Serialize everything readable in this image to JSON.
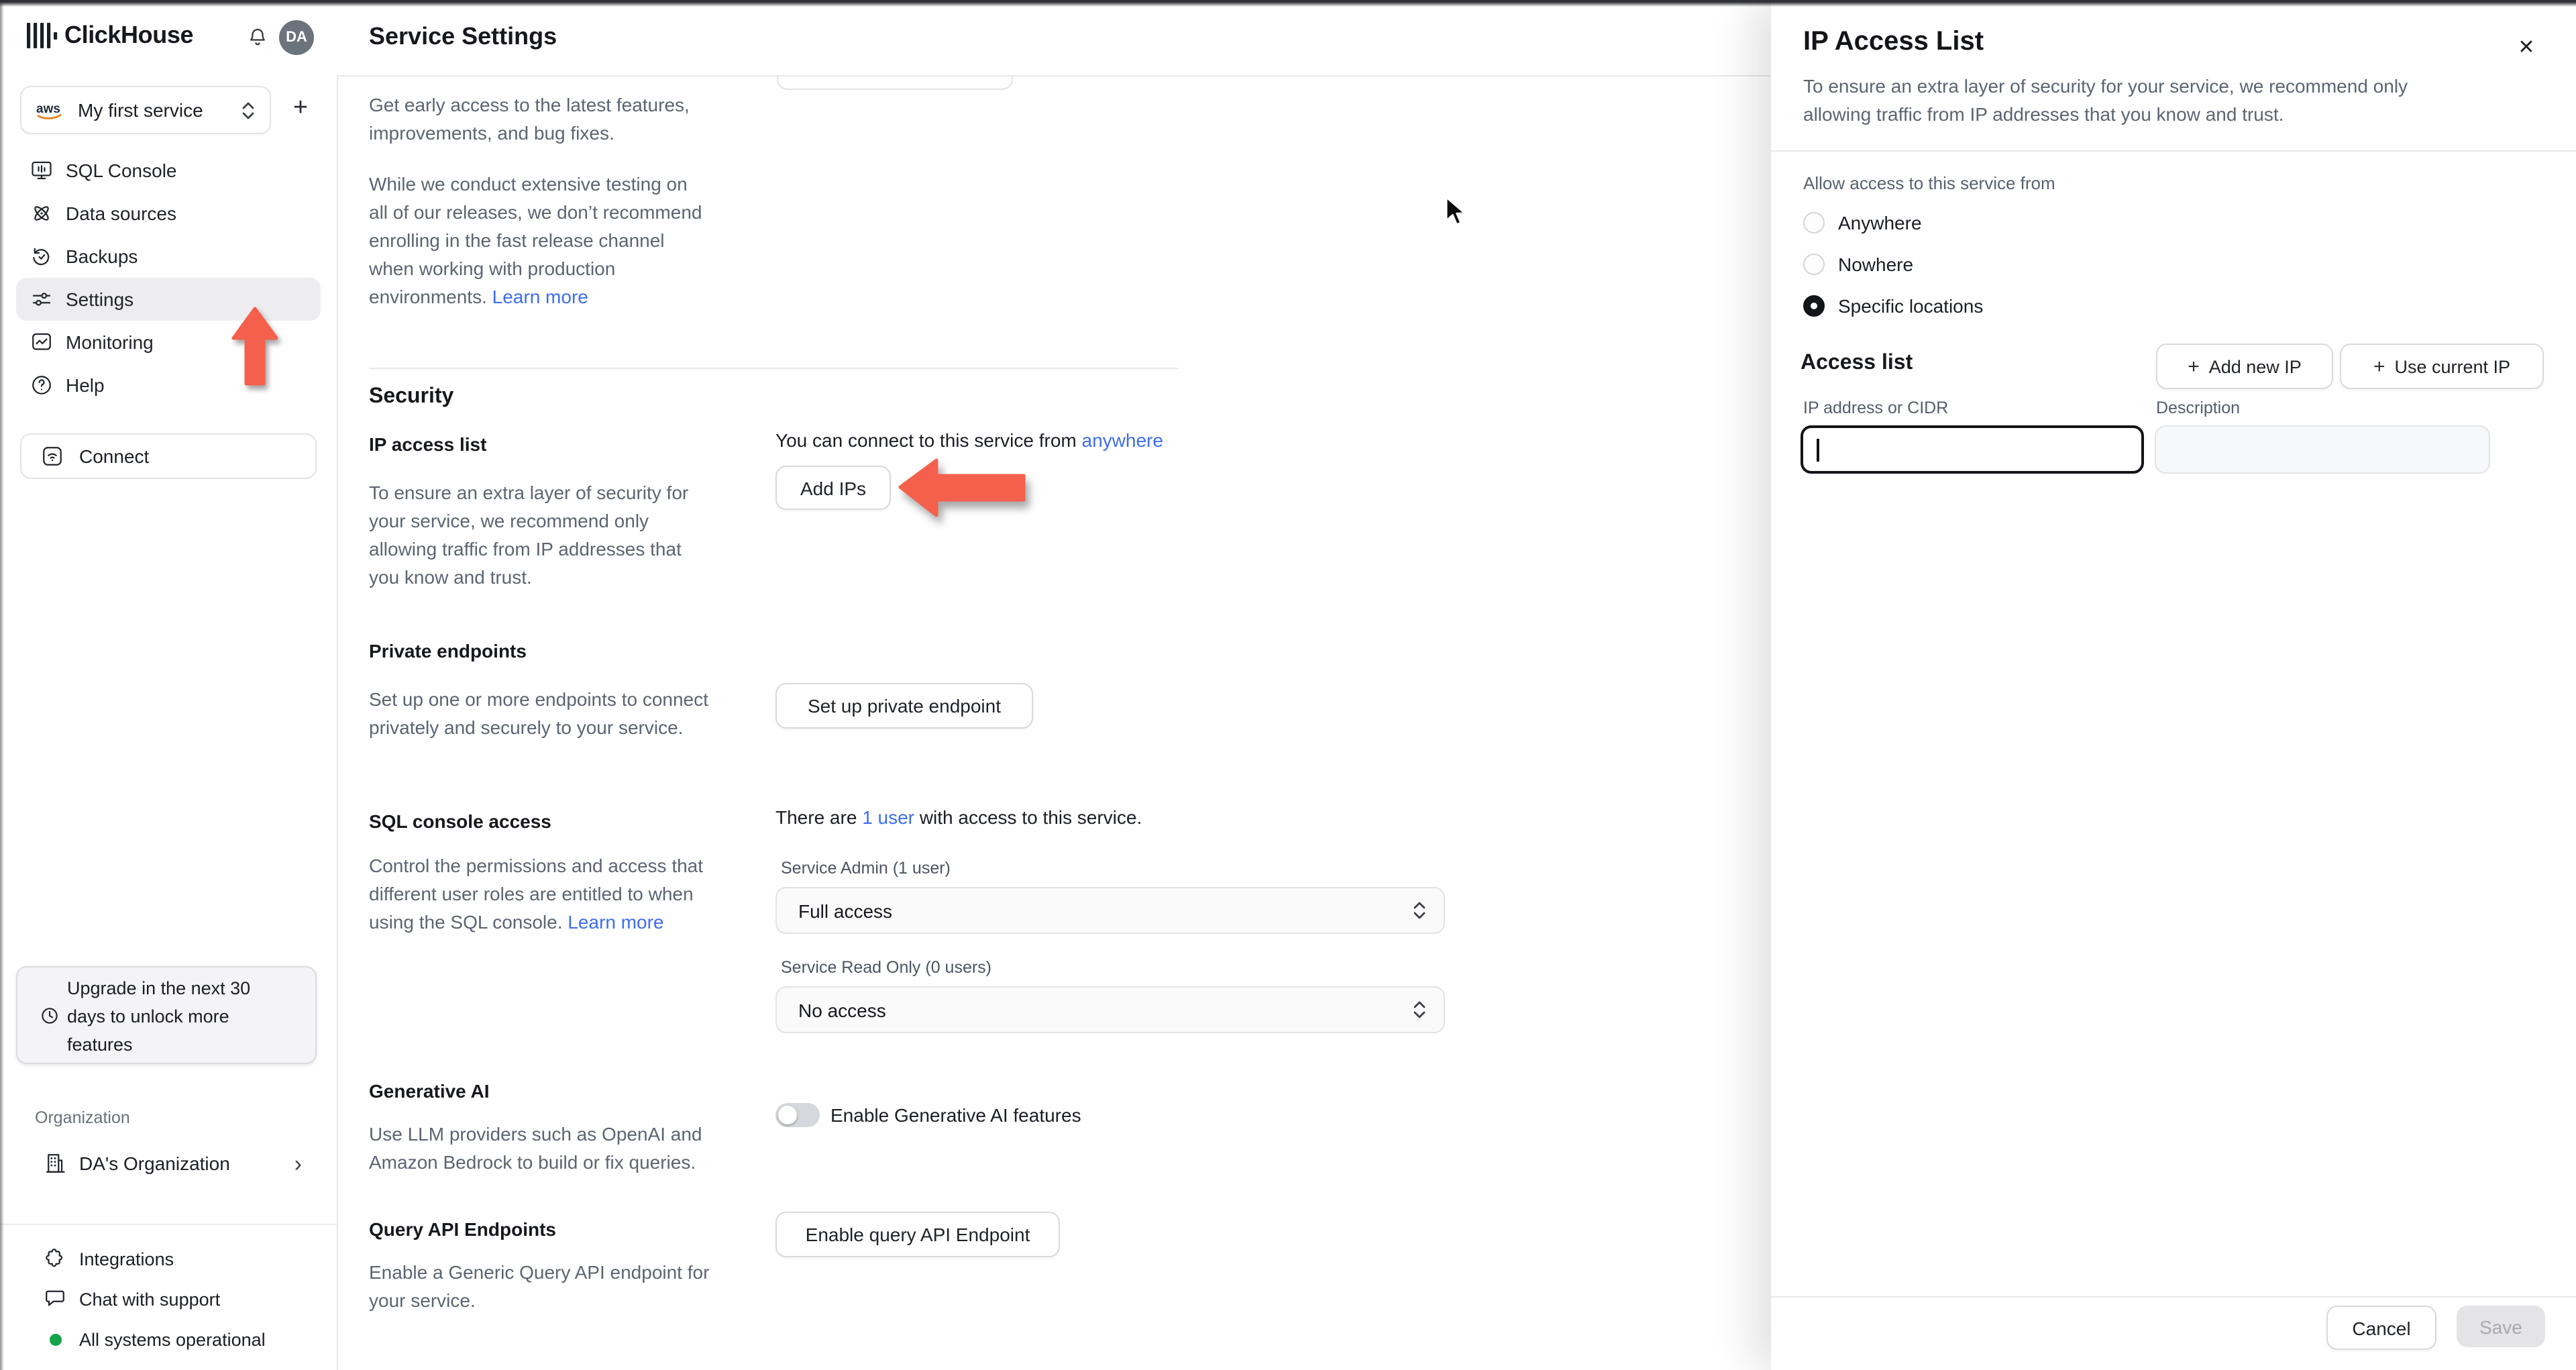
{
  "colors": {
    "link_blue": "#3e6df2",
    "arrow_red": "#f4604c",
    "status_green": "#17a34a",
    "selected_radio": "#141519"
  },
  "icons": {
    "close": "✕",
    "plus": "+",
    "chevron_right": "›"
  },
  "sidebar": {
    "brand": "ClickHouse",
    "avatar_initials": "DA",
    "service_selector": {
      "label": "My first service",
      "provider": "aws"
    },
    "add_service_label": "+",
    "nav": [
      "SQL Console",
      "Data sources",
      "Backups",
      "Settings",
      "Monitoring",
      "Help"
    ],
    "connect_label": "Connect",
    "upgrade_notice": "Upgrade in the next 30\ndays to unlock more\nfeatures",
    "org_label": "Organization",
    "org_name": "DA's Organization",
    "org_chevron": "›",
    "integrations": "Integrations",
    "chat": "Chat with support",
    "status": "All systems operational"
  },
  "main": {
    "title": "Service Settings",
    "intro_p1": "Get early access to the latest features,\nimprovements, and bug fixes.",
    "intro_p2": "While we conduct extensive testing on\nall of our releases, we don’t recommend\nenrolling in the fast release channel\nwhen working with production\nenvironments.",
    "intro_link": "Learn more",
    "security_heading": "Security",
    "ip_access": {
      "label": "IP access list",
      "desc": "To ensure an extra layer of security for\nyour service, we recommend only\nallowing traffic from IP addresses that\nyou know and trust.",
      "status_prefix": "You can connect to this service from ",
      "status_link": "anywhere",
      "button": "Add IPs"
    },
    "private_endpoints": {
      "label": "Private endpoints",
      "desc": "Set up one or more endpoints to connect\nprivately and securely to your service.",
      "button": "Set up private endpoint"
    },
    "sql_access": {
      "label": "SQL console access",
      "desc": "Control the permissions and access that\ndifferent user roles are entitled to when\nusing the SQL console.",
      "desc_link": "Learn more",
      "users_prefix": "There are ",
      "users_link": "1 user",
      "users_suffix": " with access to this service.",
      "admin_label": "Service Admin (1 user)",
      "admin_value": "Full access",
      "readonly_label": "Service Read Only (0 users)",
      "readonly_value": "No access"
    },
    "generative_ai": {
      "label": "Generative AI",
      "desc": "Use LLM providers such as OpenAI and\nAmazon Bedrock to build or fix queries.",
      "toggle_label": "Enable Generative AI features"
    },
    "query_api": {
      "label": "Query API Endpoints",
      "desc": "Enable a Generic Query API endpoint for\nyour service.",
      "button": "Enable query API Endpoint"
    }
  },
  "panel": {
    "title": "IP Access List",
    "close": "✕",
    "desc": "To ensure an extra layer of security for your service, we recommend only\nallowing traffic from IP addresses that you know and trust.",
    "allow_label": "Allow access to this service from",
    "radio_anywhere": "Anywhere",
    "radio_nowhere": "Nowhere",
    "radio_specific": "Specific locations",
    "access_heading": "Access list",
    "add_new_ip": "Add new IP",
    "use_current_ip": "Use current IP",
    "ip_field_label": "IP address or CIDR",
    "desc_field_label": "Description",
    "cancel": "Cancel",
    "save": "Save"
  }
}
